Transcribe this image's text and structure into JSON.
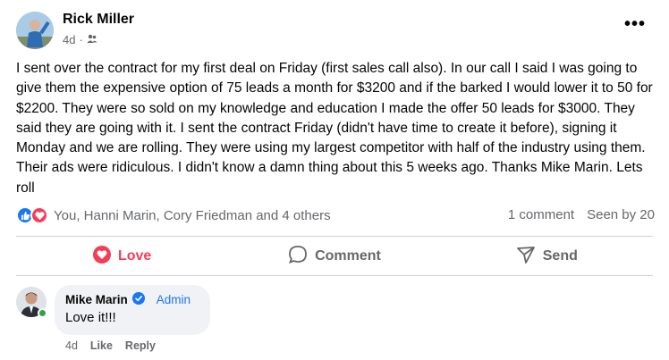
{
  "post": {
    "author": "Rick Miller",
    "time": "4d",
    "separator": "·",
    "privacy_icon": "friends-icon",
    "more_icon": "•••",
    "body": "I sent over the contract for my first deal on Friday (first sales call also). In our call I said I was going to give them the expensive option of 75 leads a month for $3200 and if the barked I would lower it to 50 for $2200. They were so sold on my knowledge and education I made the offer 50 leads for $3000. They said they are going with it. I sent the contract Friday (didn't have time to create it before), signing it Monday and we are rolling. They were using my largest competitor with half of the industry using them. Their ads were ridiculous. I didn't know a damn thing about this 5 weeks ago. Thanks Mike Marin. Lets roll"
  },
  "reactions": {
    "names": "You, Hanni Marin, Cory Friedman and 4 others",
    "icons": [
      "like-icon",
      "love-icon"
    ]
  },
  "stats": {
    "comments": "1 comment",
    "seen": "Seen by 20"
  },
  "actions": {
    "love": "Love",
    "comment": "Comment",
    "send": "Send"
  },
  "comment": {
    "author": "Mike Marin",
    "role": "Admin",
    "text": "Love it!!!",
    "time": "4d",
    "like": "Like",
    "reply": "Reply"
  },
  "colors": {
    "love": "#f33e58",
    "blue": "#1877f2",
    "muted": "#65676b"
  }
}
